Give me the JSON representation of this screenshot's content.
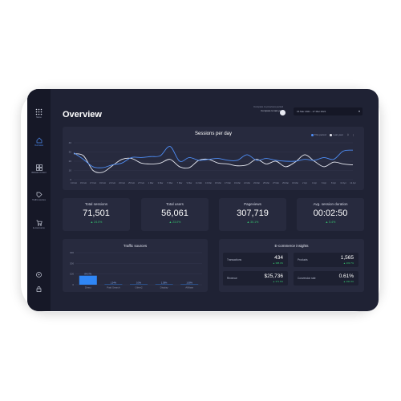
{
  "sidebar": {
    "menu_label": "Menu",
    "items": [
      {
        "label": "Overview",
        "icon": "home-icon"
      },
      {
        "label": "Website content",
        "icon": "grid-icon"
      },
      {
        "label": "Traffic sources",
        "icon": "tag-icon"
      },
      {
        "label": "E-commerce",
        "icon": "cart-icon"
      }
    ]
  },
  "header": {
    "title": "Overview",
    "compare_label_1": "Compare to previous period",
    "compare_label_2": "Compare to last year",
    "date_range": "16 Mar 2021 - 17 Mar 2021"
  },
  "sessions_chart": {
    "title": "Sessions per day",
    "legend": [
      {
        "label": "This period",
        "color": "#4e8ef7"
      },
      {
        "label": "Last year",
        "color": "#e8eaf2"
      }
    ]
  },
  "kpis": [
    {
      "label": "Total sessions",
      "value": "71,501",
      "change": "▲ 24.0%"
    },
    {
      "label": "Total users",
      "value": "56,061",
      "change": "▲ 23.0%"
    },
    {
      "label": "Pageviews",
      "value": "307,719",
      "change": "▲ 30.1%"
    },
    {
      "label": "Avg. session duration",
      "value": "00:02:50",
      "change": "▲ 5.4%"
    }
  ],
  "traffic_sources": {
    "title": "Traffic sources"
  },
  "ecommerce": {
    "title": "E-commerce insights",
    "items": [
      {
        "label": "Transactions",
        "value": "434",
        "change": "▲ 388.3%"
      },
      {
        "label": "Products",
        "value": "1,565",
        "change": "▲ 403.7%"
      },
      {
        "label": "Revenue",
        "value": "$25,736",
        "change": "▲ 371.6%"
      },
      {
        "label": "Conversion rate",
        "value": "0.61%",
        "change": "▲ 290.4%"
      }
    ]
  },
  "chart_data": [
    {
      "type": "line",
      "title": "Sessions per day",
      "x": [
        "13 Feb",
        "15 Feb",
        "17 Feb",
        "19 Feb",
        "21 Feb",
        "23 Feb",
        "25 Feb",
        "27 Feb",
        "1 Mar",
        "3 Mar",
        "5 Mar",
        "7 Mar",
        "9 Mar",
        "11 Mar",
        "13 Mar",
        "15 Mar",
        "17 Mar",
        "19 Mar",
        "21 Mar",
        "23 Mar",
        "25 Mar",
        "27 Mar",
        "29 Mar",
        "31 Mar",
        "2 Apr",
        "4 Apr",
        "6 Apr",
        "8 Apr",
        "10 Apr",
        "12 Apr"
      ],
      "ylim": [
        0,
        40
      ],
      "yticks": [
        0,
        10,
        20,
        30,
        40
      ],
      "series": [
        {
          "name": "This period",
          "color": "#4e8ef7",
          "values": [
            29,
            22,
            14,
            13,
            16,
            18,
            24,
            24,
            25,
            26,
            36,
            20,
            24,
            21,
            22,
            23,
            21,
            21,
            27,
            21,
            23,
            21,
            20,
            20,
            22,
            21,
            24,
            22,
            31,
            32
          ]
        },
        {
          "name": "Last year",
          "color": "#e8eaf2",
          "values": [
            28,
            26,
            10,
            8,
            15,
            22,
            23,
            18,
            17,
            18,
            22,
            14,
            13,
            21,
            22,
            18,
            17,
            15,
            16,
            22,
            17,
            20,
            14,
            19,
            27,
            20,
            14,
            19,
            17,
            16
          ]
        }
      ]
    },
    {
      "type": "bar",
      "title": "Traffic sources",
      "categories": [
        "Direct",
        "Paid Search",
        "Other2",
        "Display",
        "Affiliate"
      ],
      "values": [
        84.67,
        1.54,
        0.5,
        1.38,
        1.08
      ],
      "data_labels": [
        "84.67%",
        "1.54%",
        "0.5%",
        "1.38%",
        "1.08%"
      ],
      "ylim": [
        0,
        300
      ],
      "yticks": [
        0,
        100,
        200,
        300
      ],
      "color": "#2f86f6"
    }
  ]
}
